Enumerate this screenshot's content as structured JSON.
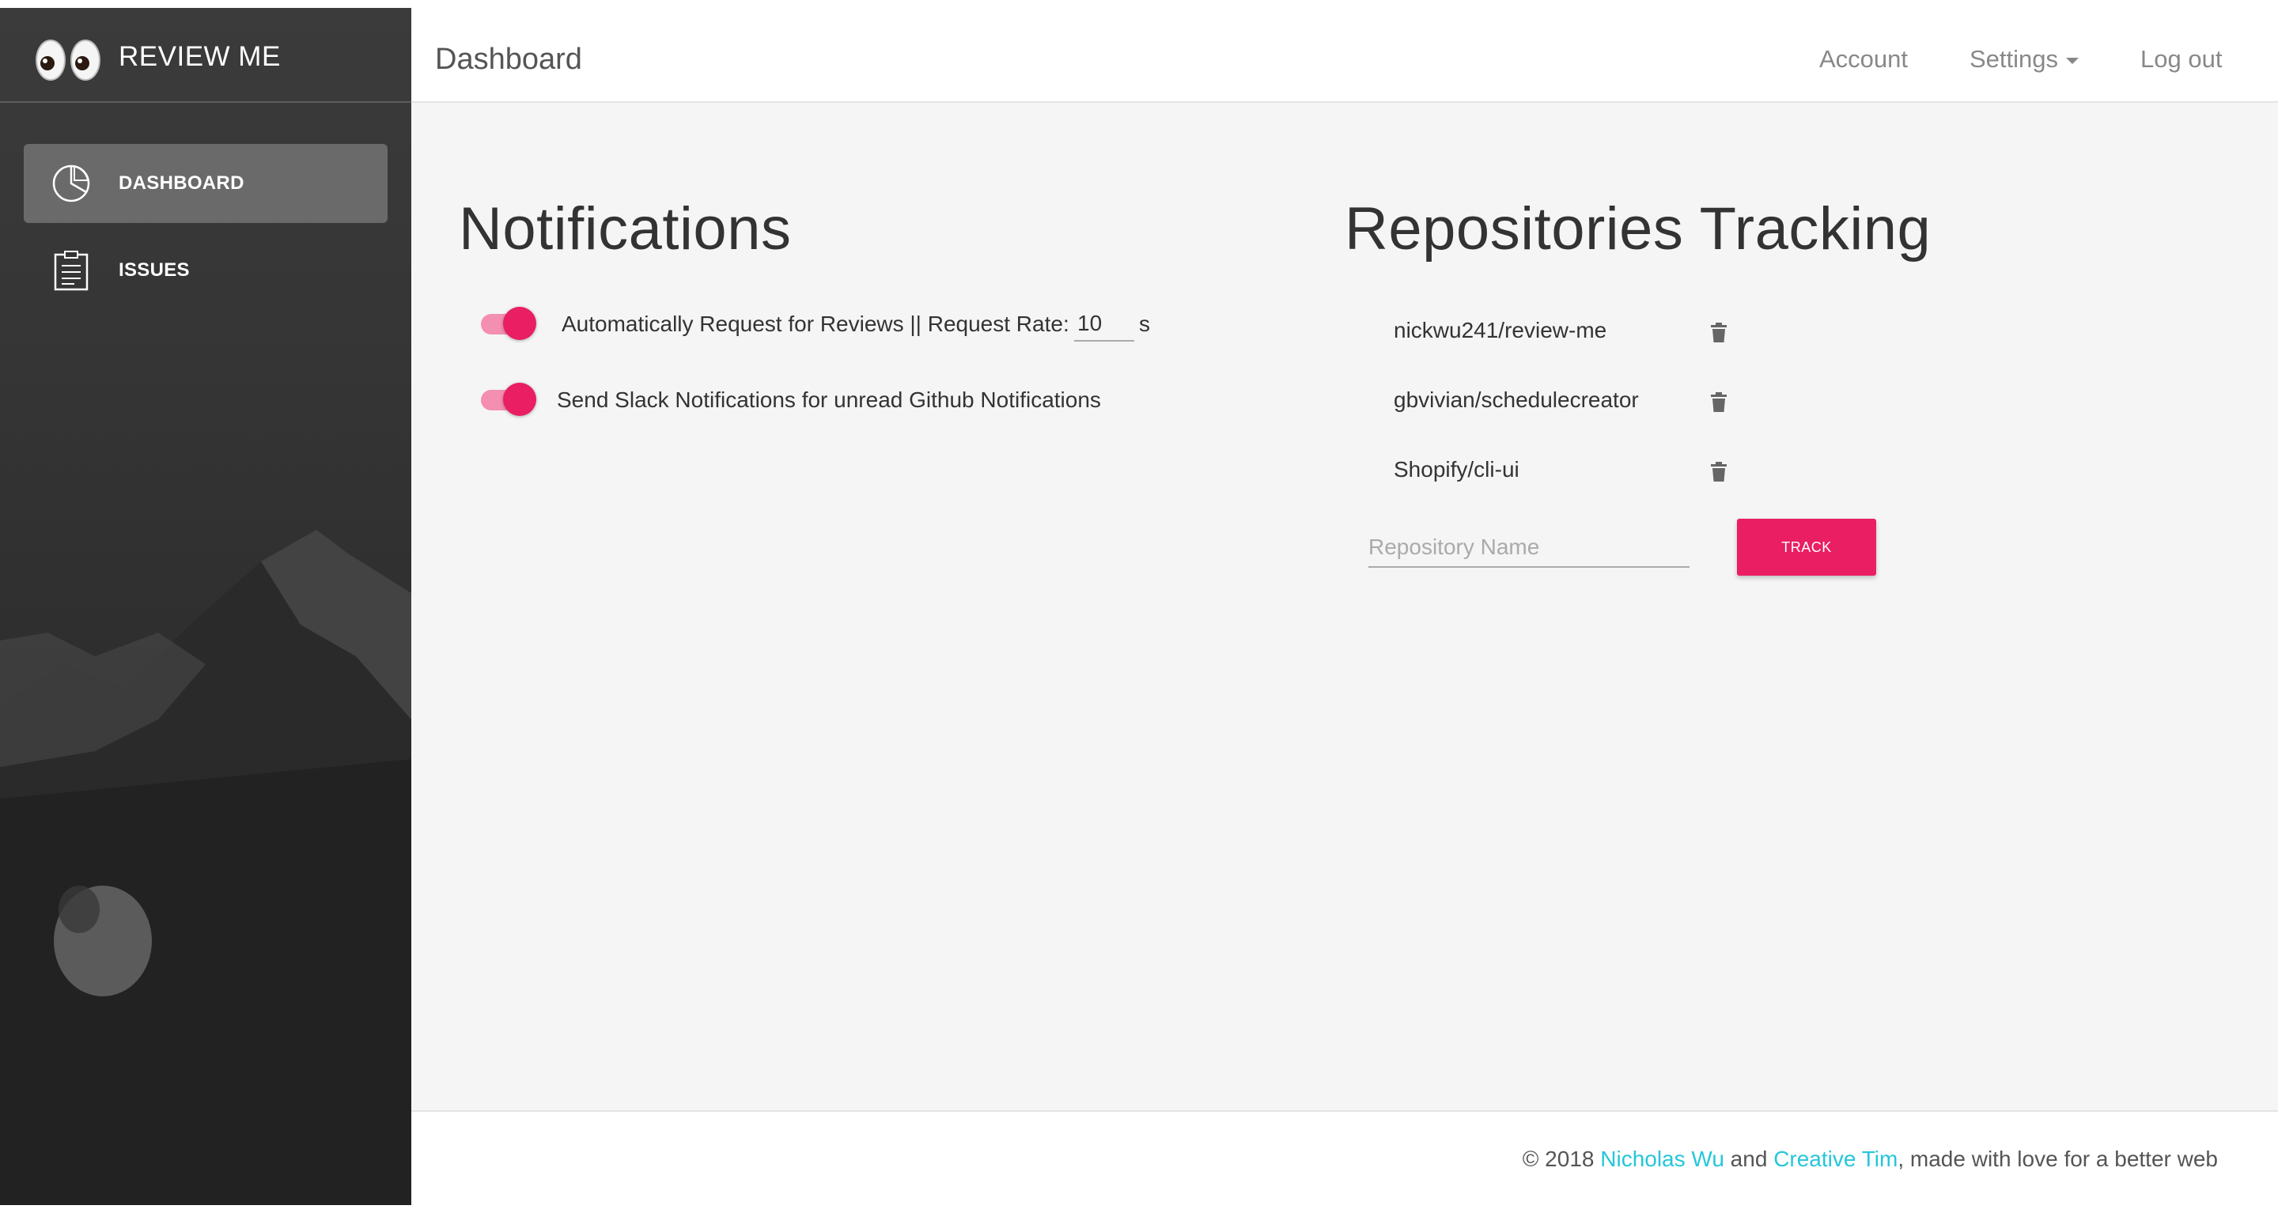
{
  "brand": {
    "title": "REVIEW ME",
    "logo_icon": "eyes-emoji-icon"
  },
  "sidebar": {
    "items": [
      {
        "label": "DASHBOARD",
        "icon": "pie-chart-icon",
        "active": true
      },
      {
        "label": "ISSUES",
        "icon": "clipboard-icon",
        "active": false
      }
    ]
  },
  "header": {
    "title": "Dashboard",
    "nav": {
      "account": "Account",
      "settings": "Settings",
      "logout": "Log out"
    }
  },
  "notifications": {
    "title": "Notifications",
    "auto_request": {
      "label": "Automatically Request for Reviews || Request Rate:",
      "rate_value": "10",
      "unit": "s",
      "enabled": true
    },
    "slack": {
      "label": "Send Slack Notifications for unread Github Notifications",
      "enabled": true
    }
  },
  "repositories": {
    "title": "Repositories Tracking",
    "items": [
      "nickwu241/review-me",
      "gbvivian/schedulecreator",
      "Shopify/cli-ui"
    ],
    "input_placeholder": "Repository Name",
    "track_label": "TRACK"
  },
  "footer": {
    "prefix": "© 2018 ",
    "author": "Nicholas Wu",
    "and": " and ",
    "partner": "Creative Tim",
    "suffix": ", made with love for a better web"
  },
  "colors": {
    "accent": "#e91e63",
    "link": "#26c6da",
    "sidebar": "#2e2e2e"
  }
}
